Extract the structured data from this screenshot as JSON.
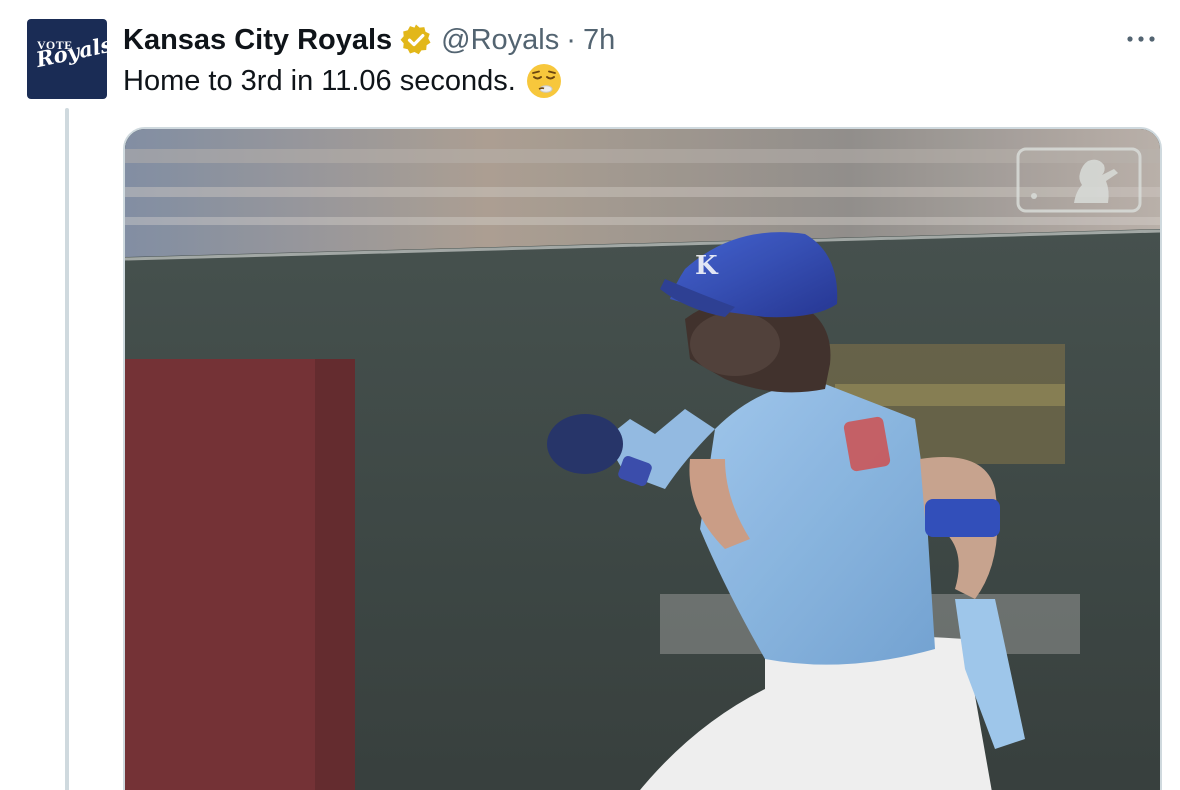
{
  "author": {
    "avatar_text_top": "VOTE",
    "avatar_text_script": "Royals",
    "display_name": "Kansas City Royals",
    "handle": "@Royals",
    "separator": "·",
    "timestamp": "7h",
    "verified_icon": "gold-verified-badge-icon"
  },
  "tweet": {
    "text": "Home to 3rd in 11.06 seconds.",
    "emoji": "relieved-sweat-face-emoji"
  },
  "media": {
    "type": "video",
    "watermark_icon": "mlb-logo-icon"
  },
  "colors": {
    "text_primary": "#0f1419",
    "text_secondary": "#536471",
    "thread_line": "#cfd9de",
    "avatar_bg": "#1a2c55",
    "verified_gold": "#e2b719"
  }
}
